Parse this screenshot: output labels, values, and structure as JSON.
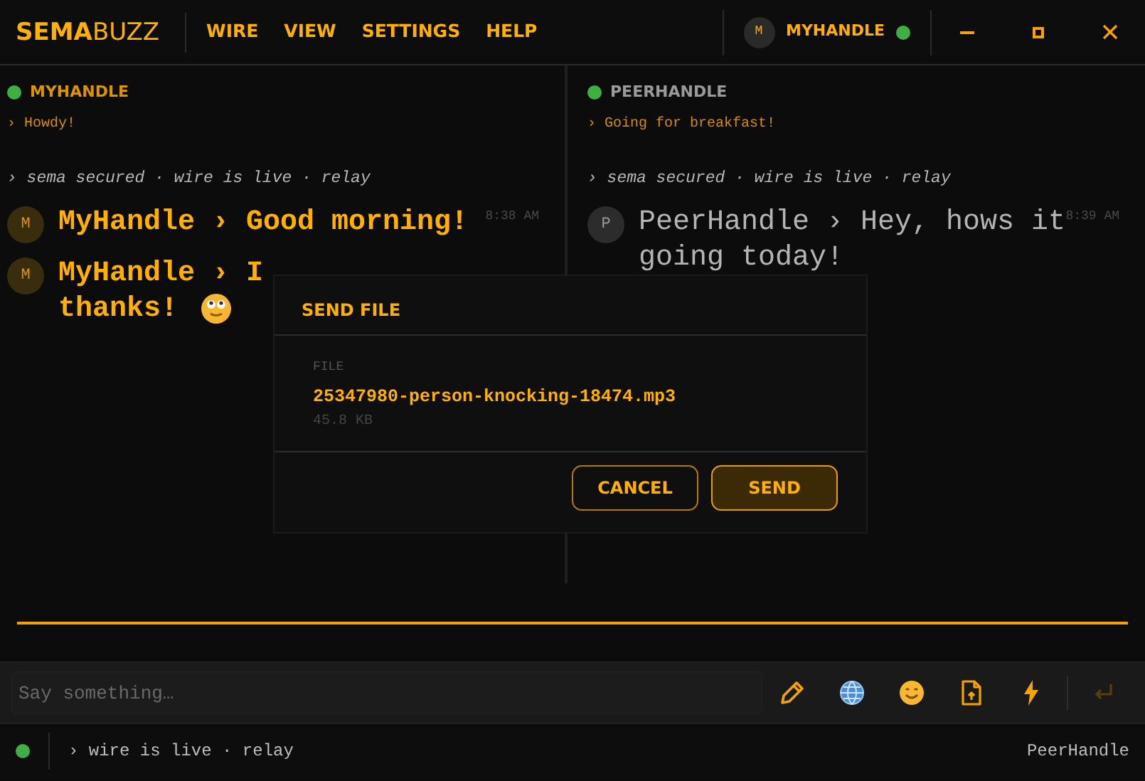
{
  "app": {
    "logo_bold": "SEMA",
    "logo_light": "BUZZ"
  },
  "menu": [
    "WIRE",
    "VIEW",
    "SETTINGS",
    "HELP"
  ],
  "account": {
    "avatar": "M",
    "handle": "MYHANDLE",
    "online": true
  },
  "panes": [
    {
      "self": true,
      "online": true,
      "handle": "MYHANDLE",
      "status": "› Howdy!",
      "info": "› sema secured · wire is live · relay",
      "messages": [
        {
          "avatar": "M",
          "author": "MyHandle",
          "text": "› Good morning!",
          "time": "8:38 AM",
          "emoji": false
        },
        {
          "avatar": "M",
          "author": "MyHandle",
          "text": "› I",
          "continuation": "thanks!",
          "emoji": true
        }
      ]
    },
    {
      "self": false,
      "online": true,
      "handle": "PEERHANDLE",
      "status": "› Going for breakfast!",
      "info": "› sema secured · wire is live · relay",
      "messages": [
        {
          "avatar": "P",
          "author": "PeerHandle",
          "text": "› Hey, hows it",
          "continuation": "going today!",
          "time": "8:39 AM",
          "emoji": false
        }
      ]
    }
  ],
  "composer": {
    "placeholder": "Say something…",
    "send_enabled": false
  },
  "status_bar": {
    "online": true,
    "text": "› wire is live · relay",
    "peer": "PeerHandle"
  },
  "dialog": {
    "title": "SEND FILE",
    "label": "FILE",
    "filename": "25347980-person-knocking-18474.mp3",
    "size": "45.8 KB",
    "buttons": [
      {
        "label": "CANCEL",
        "kind": "secondary"
      },
      {
        "label": "SEND",
        "kind": "primary"
      }
    ]
  }
}
